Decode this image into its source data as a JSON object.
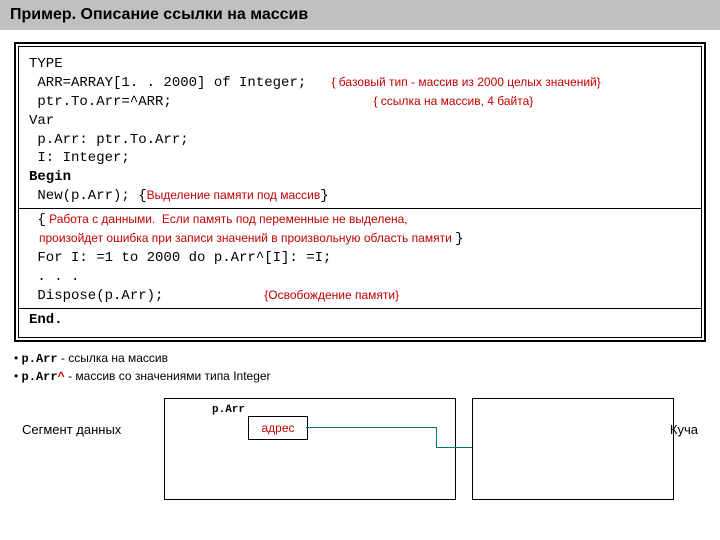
{
  "title": "Пример. Описание ссылки на массив",
  "code": {
    "l1": "TYPE",
    "l2": " ARR=ARRAY[1. . 2000] of Integer;",
    "c2": "{ базовый тип - массив из 2000 целых значений}",
    "l3": " ptr.To.Arr=^ARR;",
    "c3": "{ ссылка на массив, 4 байта}",
    "l4": "Var",
    "l5": " p.Arr: ptr.To.Arr;",
    "l6": " I: Integer;",
    "l7": "Begin",
    "l8a": " New(p.Arr); {",
    "c8": "Выделение памяти под массив",
    "l8b": "}",
    "l9": " {",
    "c9a": " Работа с данными.  Если память под переменные не выделена,",
    "c9b": "   произойдет ошибка при записи значений в произвольную область памяти ",
    "l9b": "}",
    "l10": " For I: =1 to 2000 do p.Arr^[I]: =I;",
    "l11": " . . .",
    "l12": " Dispose(p.Arr);",
    "c12": "{Освобождение памяти}",
    "l13": "End."
  },
  "bullets": {
    "b1mono": "p.Arr",
    "b1text": "  - ссылка на массив",
    "b2mono": "p.Arr",
    "b2caret": "^",
    "b2text": "  - массив со значениями типа Integer"
  },
  "diagram": {
    "seg": "Сегмент данных",
    "parr": "p.Arr",
    "addr": "адрес",
    "heap": "Куча"
  }
}
